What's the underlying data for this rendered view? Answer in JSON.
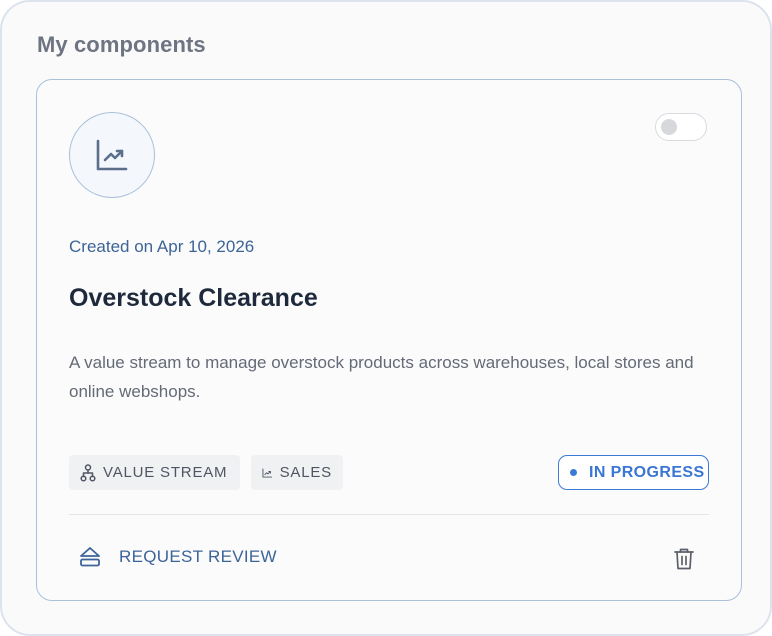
{
  "section": {
    "title": "My components"
  },
  "card": {
    "icon": "trending-up-chart-icon",
    "toggle": {
      "state": "off"
    },
    "created": "Created on Apr 10, 2026",
    "title": "Overstock Clearance",
    "description": "A value stream to manage overstock products across warehouses, local stores and online webshops.",
    "tags": [
      {
        "label": "VALUE STREAM",
        "icon": "hierarchy-icon"
      },
      {
        "label": "SALES",
        "icon": "trending-up-icon"
      }
    ],
    "status": {
      "label": "IN PROGRESS",
      "color": "#3c7ad8"
    },
    "actions": {
      "request_review_label": "REQUEST REVIEW",
      "request_review_icon": "eject-icon",
      "delete_icon": "trash-icon"
    }
  },
  "colors": {
    "accent": "#3c7ad8",
    "link": "#3c6497",
    "title": "#1e2a3b",
    "card_border": "#a9c0da"
  }
}
